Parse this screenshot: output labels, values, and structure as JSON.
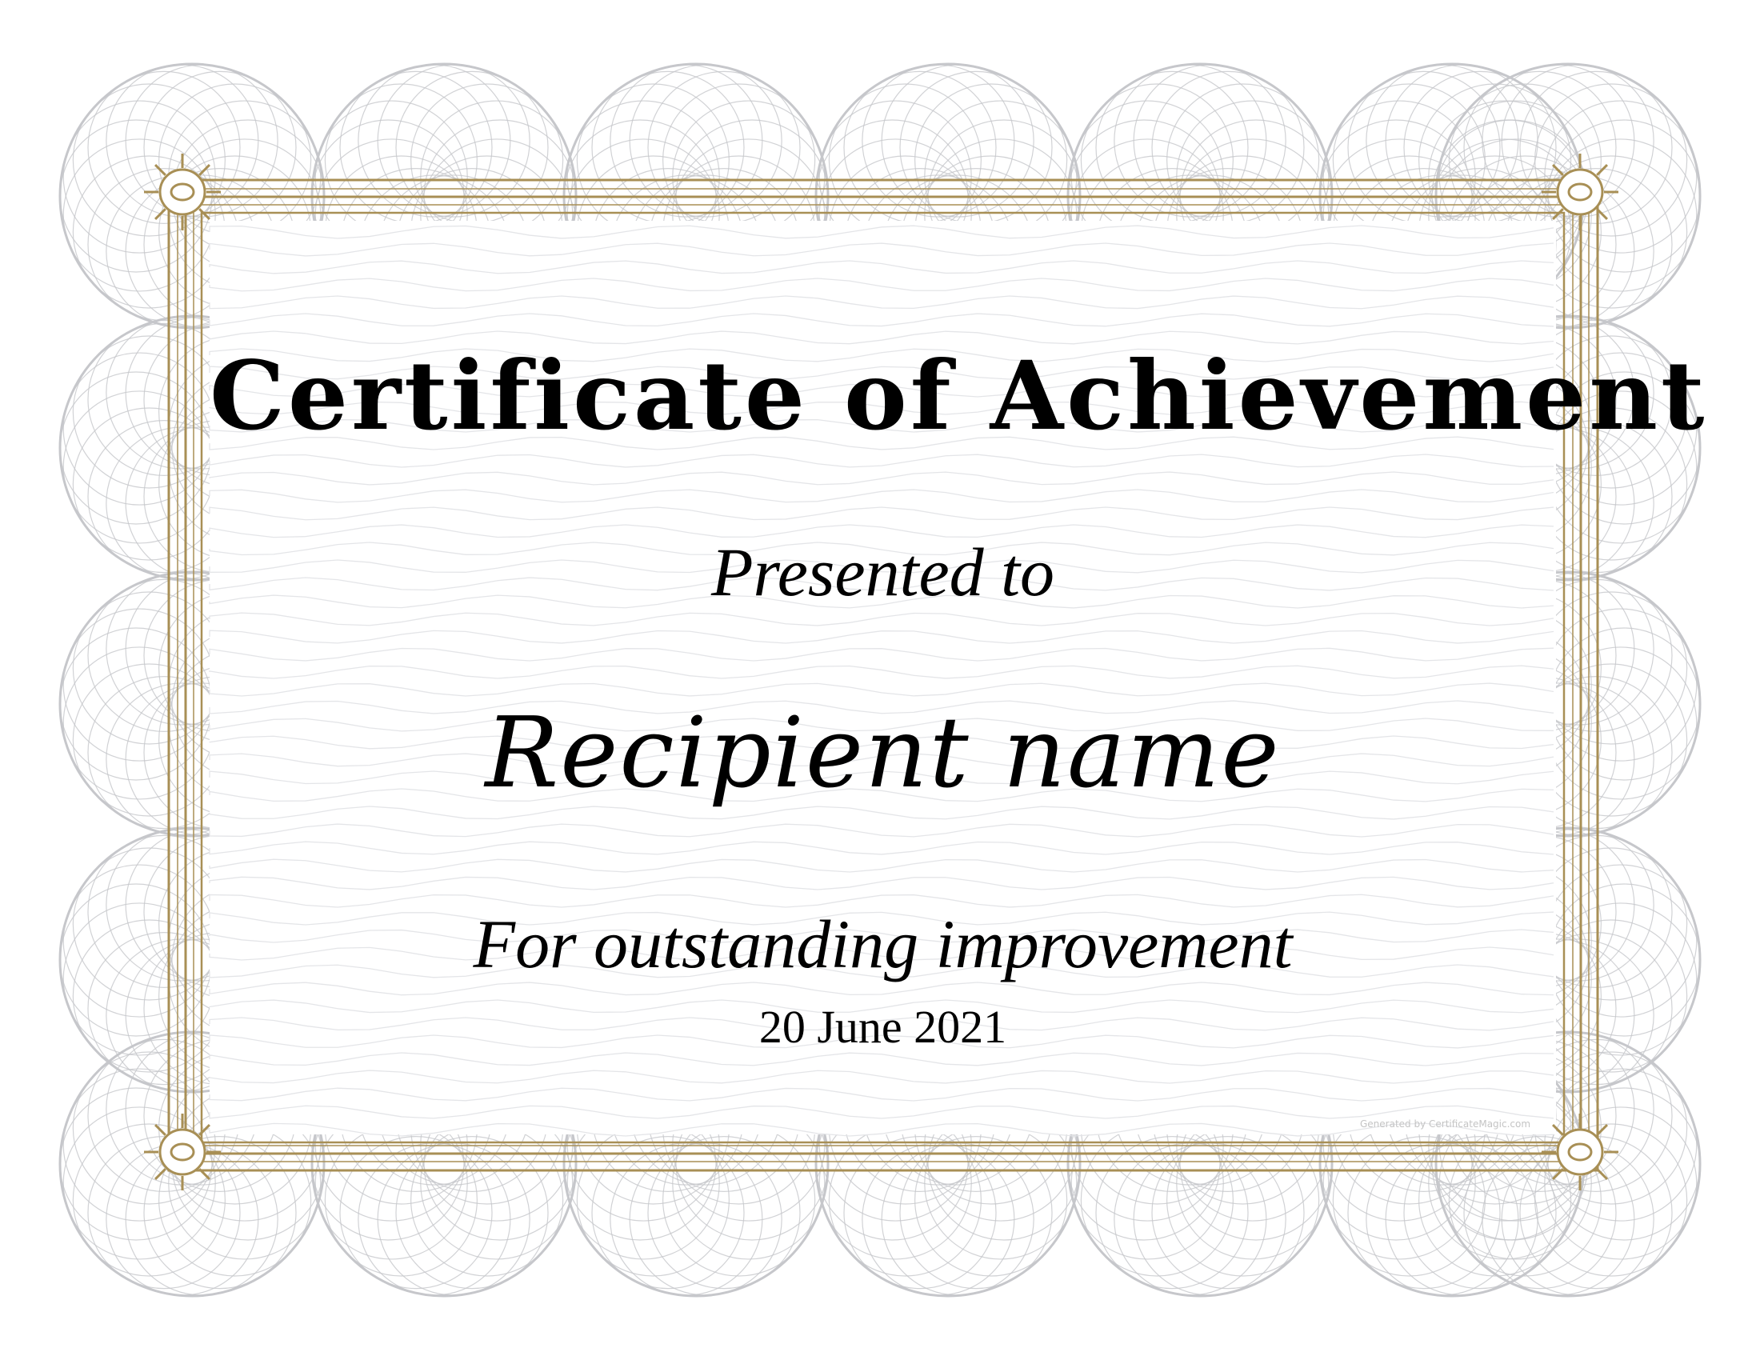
{
  "certificate": {
    "title": "Certificate of Achievement",
    "presented_label": "Presented to",
    "recipient": "Recipient name",
    "reason": "For outstanding improvement",
    "date": "20 June 2021",
    "watermark": "Generated by CertificateMagic.com"
  },
  "colors": {
    "frame_gold": "#a88f55",
    "guilloche_gray": "#c6c7cb",
    "text": "#000000"
  }
}
